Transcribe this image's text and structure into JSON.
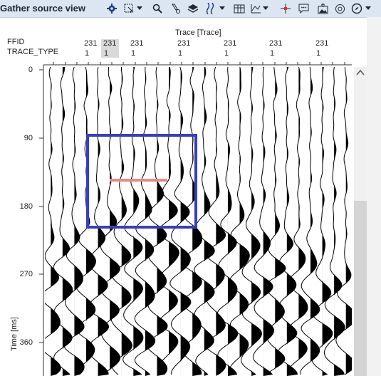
{
  "window": {
    "title": "Gather source view"
  },
  "toolbar": {
    "icons": [
      "gear-icon",
      "select-region-icon",
      "search-icon",
      "pick-icon",
      "layers-icon",
      "wiggle-display-icon",
      "table-icon",
      "chart-icon",
      "crosshair-icon",
      "comment-icon",
      "export-image-icon",
      "target-icon",
      "compass-icon"
    ]
  },
  "header": {
    "axis_title": "Trace [Trace]",
    "row1_label": "FFID",
    "row2_label": "TRACE_TYPE",
    "ffid_values": [
      "231",
      "231",
      "231",
      "231",
      "231",
      "231",
      "231"
    ],
    "trace_type_values": [
      "1",
      "1",
      "1",
      "1",
      "1",
      "1",
      "1"
    ]
  },
  "yaxis": {
    "label": "Time [ms]",
    "ticks": [
      "0",
      "90",
      "180",
      "270",
      "360"
    ]
  },
  "annotations": {
    "box_color": "#3a3fb5",
    "line_color": "#e08a8a"
  }
}
